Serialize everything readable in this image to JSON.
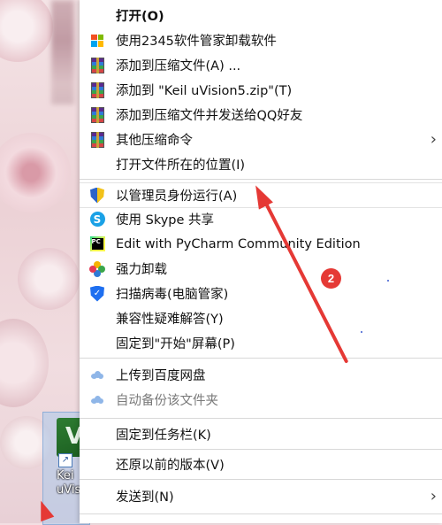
{
  "desktop": {
    "shortcut_label_line1": "Kei",
    "shortcut_label_line2": "uVisi"
  },
  "menu": {
    "items": [
      {
        "label": "打开(O)",
        "bold": true
      },
      {
        "label": "使用2345软件管家卸载软件",
        "icon": "app-grid-icon"
      },
      {
        "label": "添加到压缩文件(A) ...",
        "icon": "winrar-icon"
      },
      {
        "label": "添加到 \"Keil uVision5.zip\"(T)",
        "icon": "winrar-icon"
      },
      {
        "label": "添加到压缩文件并发送给QQ好友",
        "icon": "winrar-icon"
      },
      {
        "label": "其他压缩命令",
        "icon": "winrar-icon",
        "submenu": true
      },
      {
        "label": "打开文件所在的位置(I)"
      },
      {
        "label": "以管理员身份运行(A)",
        "icon": "uac-shield-icon"
      },
      {
        "label": "使用 Skype 共享",
        "icon": "skype-icon"
      },
      {
        "label": "Edit with PyCharm Community Edition",
        "icon": "pycharm-icon"
      },
      {
        "label": "强力卸载",
        "icon": "flower-icon"
      },
      {
        "label": "扫描病毒(电脑管家)",
        "icon": "shield-check-icon"
      },
      {
        "label": "兼容性疑难解答(Y)"
      },
      {
        "label": "固定到\"开始\"屏幕(P)"
      },
      {
        "label": "上传到百度网盘",
        "icon": "baidu-cloud-icon"
      },
      {
        "label": "自动备份该文件夹",
        "icon": "baidu-cloud-icon",
        "disabled": true
      },
      {
        "label": "固定到任务栏(K)"
      },
      {
        "label": "还原以前的版本(V)"
      },
      {
        "label": "发送到(N)",
        "submenu": true
      }
    ]
  },
  "annotation": {
    "step_number": "2"
  },
  "colors": {
    "annotation_red": "#e53935",
    "menu_bg": "#ffffff"
  }
}
